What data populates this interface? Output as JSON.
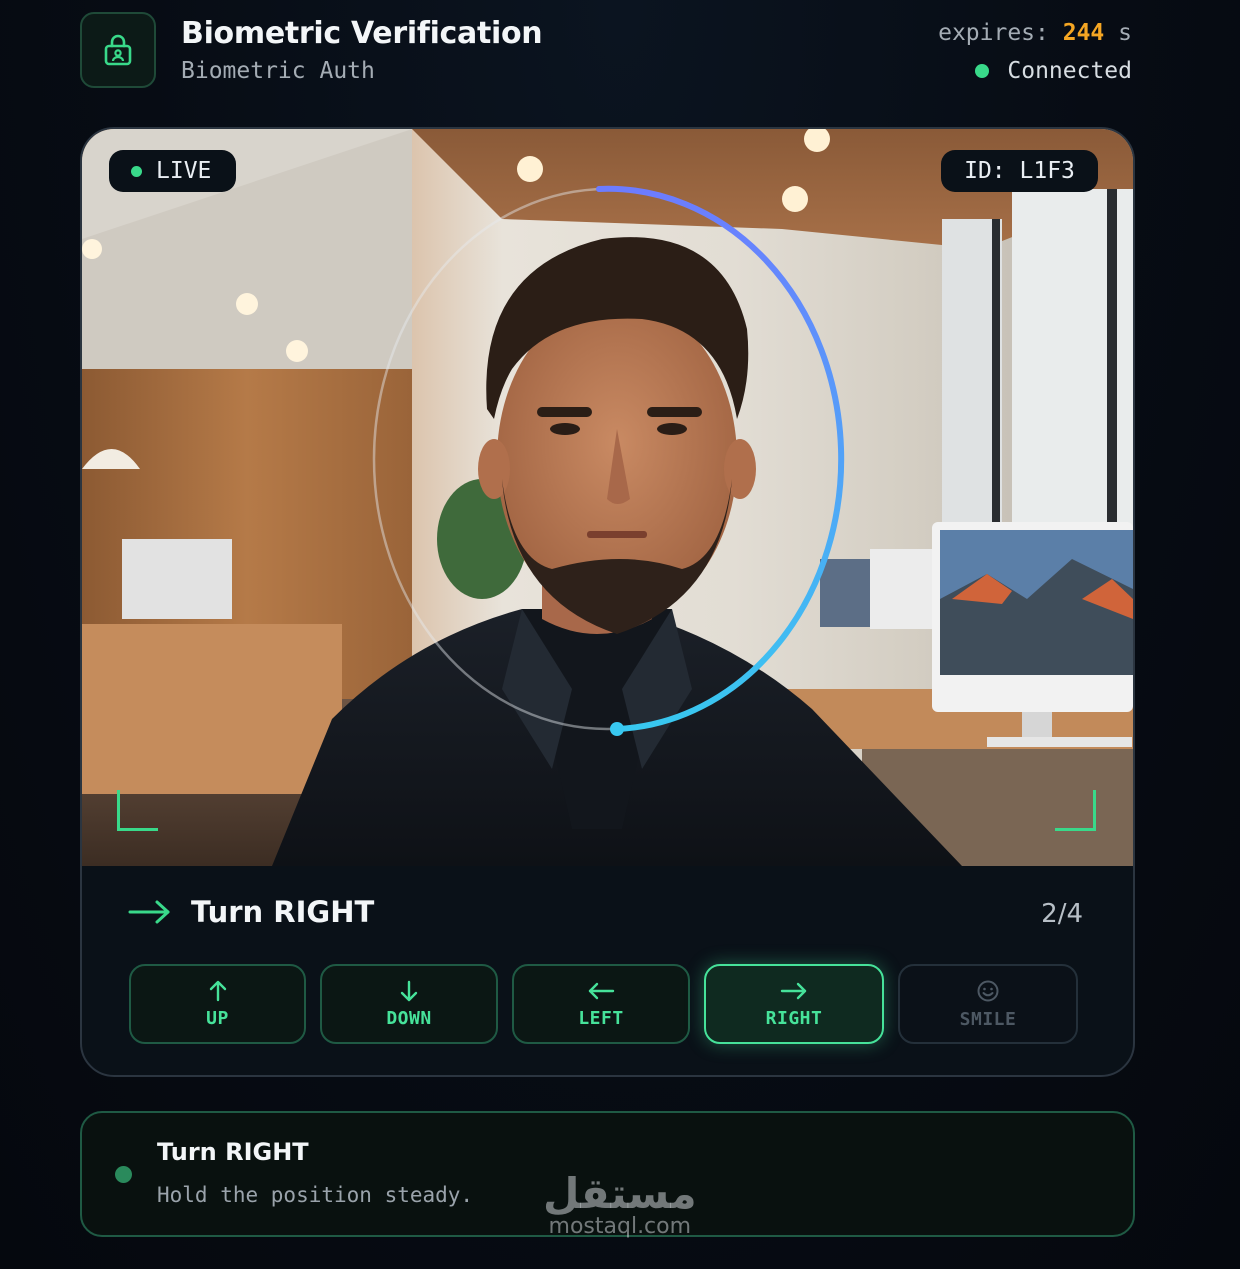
{
  "header": {
    "title": "Biometric Verification",
    "subtitle": "Biometric Auth",
    "expires_label": "expires:",
    "expires_value": "244",
    "expires_unit": "s",
    "connection_status": "Connected",
    "logo_icon": "lock-person-icon"
  },
  "camera": {
    "live_label": "LIVE",
    "session_id": "ID: L1F3",
    "scan_progress": 0.5
  },
  "instruction": {
    "text": "Turn RIGHT",
    "step": "2/4",
    "icon": "arrow-right-icon"
  },
  "actions": [
    {
      "label": "UP",
      "icon": "arrow-up-icon",
      "state": "done"
    },
    {
      "label": "DOWN",
      "icon": "arrow-down-icon",
      "state": "done"
    },
    {
      "label": "LEFT",
      "icon": "arrow-left-icon",
      "state": "done"
    },
    {
      "label": "RIGHT",
      "icon": "arrow-right-icon",
      "state": "active"
    },
    {
      "label": "SMILE",
      "icon": "smile-icon",
      "state": "disabled"
    }
  ],
  "status": {
    "title": "Turn RIGHT",
    "message": "Hold the position steady."
  },
  "watermark": {
    "arabic": "مستقل",
    "latin": "mostaql.com"
  },
  "colors": {
    "accent": "#39d98a",
    "warning": "#f5a623",
    "ring_start": "#6c7cff",
    "ring_end": "#38c8f0"
  }
}
